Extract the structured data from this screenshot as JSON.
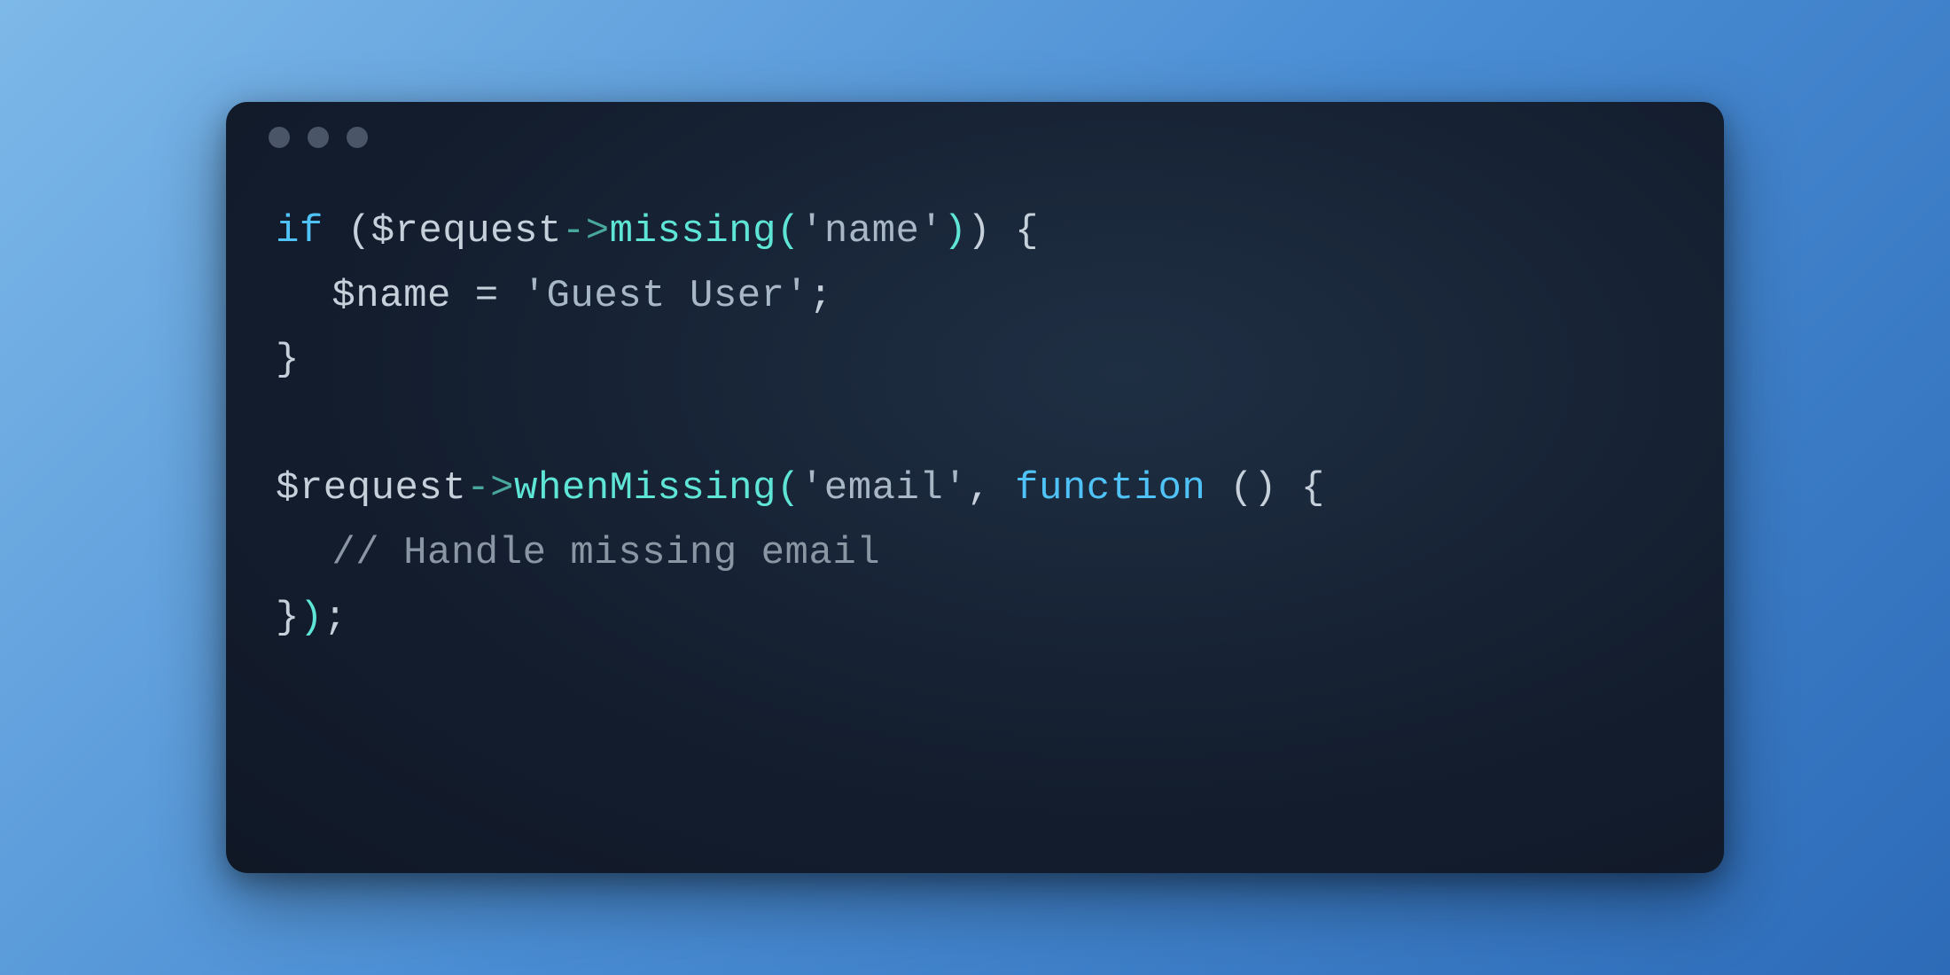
{
  "colors": {
    "bg_gradient_start": "#7db8e8",
    "bg_gradient_end": "#2d6bb8",
    "window_bg": "#131d2e",
    "dot": "#4a5568",
    "keyword": "#4fc3f7",
    "method": "#5ee5d6",
    "default": "#c5d0db",
    "comment": "#8a96a3"
  },
  "code": {
    "line1": {
      "if": "if",
      "sp1": " ",
      "lparen": "(",
      "var": "$request",
      "arrow": "->",
      "method": "missing",
      "lparen2": "(",
      "str": "'name'",
      "rparen2": ")",
      "rparen": ")",
      "sp2": " ",
      "brace": "{"
    },
    "line2": {
      "var": "$name",
      "sp1": " ",
      "eq": "=",
      "sp2": " ",
      "str": "'Guest User'",
      "semi": ";"
    },
    "line3": {
      "brace": "}"
    },
    "line5": {
      "var": "$request",
      "arrow": "->",
      "method": "whenMissing",
      "lparen": "(",
      "str": "'email'",
      "comma": ",",
      "sp1": " ",
      "fn": "function",
      "sp2": " ",
      "lparen2": "(",
      "rparen2": ")",
      "sp3": " ",
      "brace": "{"
    },
    "line6": {
      "comment": "// Handle missing email"
    },
    "line7": {
      "brace": "}",
      "rparen": ")",
      "semi": ";"
    }
  }
}
